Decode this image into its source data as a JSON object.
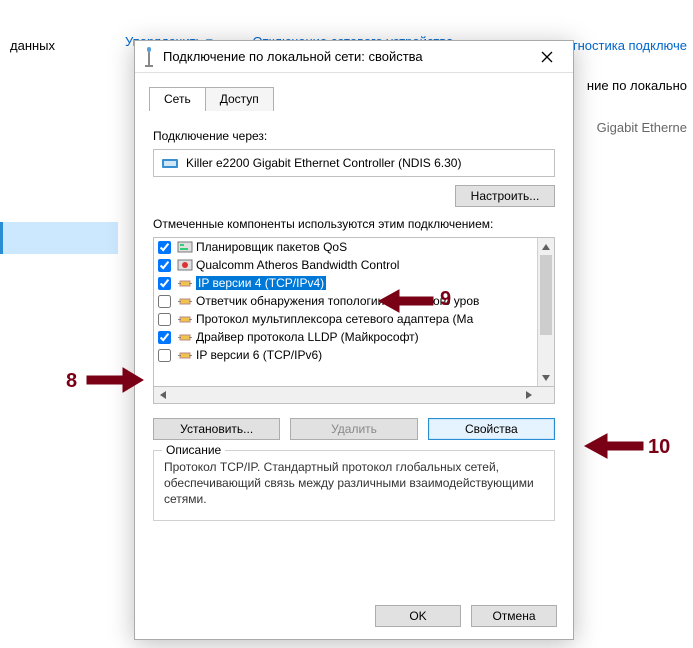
{
  "background": {
    "left_text": "данных",
    "menu": [
      "Упорядочить ▾",
      "Отключение сетевого устройства",
      "Диагностика подключе"
    ],
    "right_line1": "ние по локально",
    "right_line2": "Gigabit Etherne"
  },
  "dialog": {
    "title": "Подключение по локальной сети: свойства",
    "tabs": {
      "network": "Сеть",
      "access": "Доступ"
    },
    "conn_via_label": "Подключение через:",
    "adapter_name": "Killer e2200 Gigabit Ethernet Controller (NDIS 6.30)",
    "configure_btn": "Настроить...",
    "components_label": "Отмеченные компоненты используются этим подключением:",
    "items": [
      {
        "checked": true,
        "label": "Планировщик пакетов QoS",
        "kind": "scheduler"
      },
      {
        "checked": true,
        "label": "Qualcomm Atheros Bandwidth Control",
        "kind": "qualcomm"
      },
      {
        "checked": true,
        "label": "IP версии 4 (TCP/IPv4)",
        "kind": "proto",
        "selected": true
      },
      {
        "checked": false,
        "label": "Ответчик обнаружения топологии канального уров",
        "kind": "proto"
      },
      {
        "checked": false,
        "label": "Протокол мультиплексора сетевого адаптера (Ма",
        "kind": "proto"
      },
      {
        "checked": true,
        "label": "Драйвер протокола LLDP (Майкрософт)",
        "kind": "proto"
      },
      {
        "checked": false,
        "label": "IP версии 6 (TCP/IPv6)",
        "kind": "proto"
      }
    ],
    "install_btn": "Установить...",
    "remove_btn": "Удалить",
    "props_btn": "Свойства",
    "desc_title": "Описание",
    "desc_text": "Протокол TCP/IP. Стандартный протокол глобальных сетей, обеспечивающий связь между различными взаимодействующими сетями.",
    "ok": "OK",
    "cancel": "Отмена"
  },
  "annotations": {
    "n8": "8",
    "n9": "9",
    "n10": "10"
  }
}
